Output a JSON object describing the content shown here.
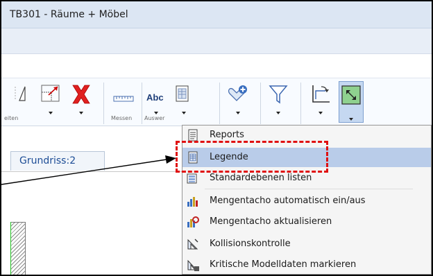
{
  "window": {
    "title": "TB301 - Räume + Möbel"
  },
  "ribbon": {
    "groups": [
      {
        "label": "eiten"
      },
      {
        "label": "Messen"
      },
      {
        "label": "Auswer"
      }
    ],
    "abc_label": "Abc"
  },
  "document_tab": {
    "label": "Grundriss:2"
  },
  "menu": {
    "items": [
      {
        "label": "Reports",
        "icon": "reports-icon"
      },
      {
        "label": "Legende",
        "icon": "legend-icon",
        "highlighted": true
      },
      {
        "label": "Standardebenen listen",
        "icon": "layer-list-icon"
      },
      {
        "label": "Mengentacho automatisch ein/aus",
        "icon": "quantity-meter-toggle-icon"
      },
      {
        "label": "Mengentacho aktualisieren",
        "icon": "quantity-meter-refresh-icon"
      },
      {
        "label": "Kollisionskontrolle",
        "icon": "collision-check-icon"
      },
      {
        "label": "Kritische Modelldaten markieren",
        "icon": "critical-data-icon"
      }
    ]
  },
  "colors": {
    "highlight": "#b9cce9",
    "annotation": "#e01010",
    "tab_text": "#1d4d96"
  }
}
